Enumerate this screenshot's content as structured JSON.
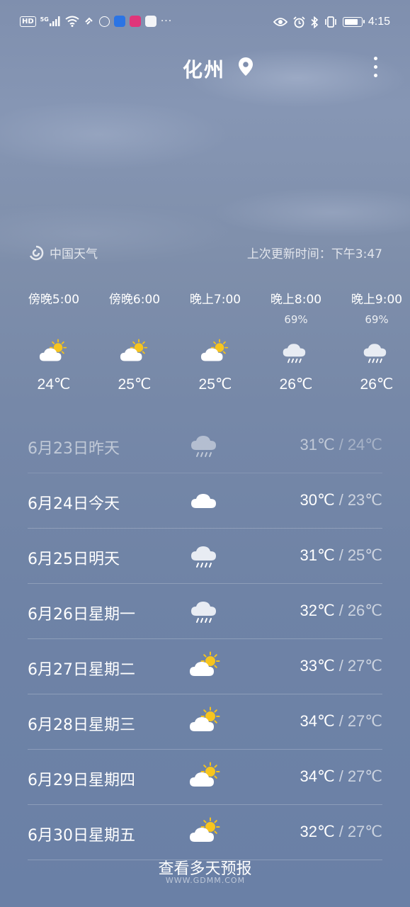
{
  "status_bar": {
    "hd": "HD",
    "network": "5G",
    "time": "4:15",
    "battery_level": 0.85,
    "left_icons": [
      "hd-icon",
      "5g-signal-icon",
      "wifi-icon",
      "sync-icon",
      "jdm-app-icon",
      "bird-app-icon",
      "news-app-icon",
      "qq-app-icon",
      "more-notifications-icon"
    ],
    "right_icons": [
      "eye-comfort-icon",
      "alarm-icon",
      "bluetooth-icon",
      "vibrate-icon",
      "battery-icon"
    ]
  },
  "header": {
    "city": "化州"
  },
  "source": {
    "name": "中国天气",
    "updated_label": "上次更新时间：",
    "updated_time": "下午3:47"
  },
  "hourly": [
    {
      "time": "傍晚5:00",
      "prob": "",
      "temp": "24℃",
      "icon": "partly-sunny-icon"
    },
    {
      "time": "傍晚6:00",
      "prob": "",
      "temp": "25℃",
      "icon": "partly-sunny-icon"
    },
    {
      "time": "晚上7:00",
      "prob": "",
      "temp": "25℃",
      "icon": "partly-sunny-icon"
    },
    {
      "time": "晚上8:00",
      "prob": "69%",
      "temp": "26℃",
      "icon": "rain-icon"
    },
    {
      "time": "晚上9:00",
      "prob": "69%",
      "temp": "26℃",
      "icon": "rain-icon"
    }
  ],
  "daily": [
    {
      "date": "6月23日",
      "day": "昨天",
      "high": "31℃",
      "low": "24℃",
      "icon": "rain-icon",
      "past": true
    },
    {
      "date": "6月24日",
      "day": "今天",
      "high": "30℃",
      "low": "23℃",
      "icon": "cloudy-icon",
      "past": false
    },
    {
      "date": "6月25日",
      "day": "明天",
      "high": "31℃",
      "low": "25℃",
      "icon": "rain-icon",
      "past": false
    },
    {
      "date": "6月26日",
      "day": "星期一",
      "high": "32℃",
      "low": "26℃",
      "icon": "rain-icon",
      "past": false
    },
    {
      "date": "6月27日",
      "day": "星期二",
      "high": "33℃",
      "low": "27℃",
      "icon": "partly-sunny-icon",
      "past": false
    },
    {
      "date": "6月28日",
      "day": "星期三",
      "high": "34℃",
      "low": "27℃",
      "icon": "partly-sunny-icon",
      "past": false
    },
    {
      "date": "6月29日",
      "day": "星期四",
      "high": "34℃",
      "low": "27℃",
      "icon": "partly-sunny-icon",
      "past": false
    },
    {
      "date": "6月30日",
      "day": "星期五",
      "high": "32℃",
      "low": "27℃",
      "icon": "partly-sunny-icon",
      "past": false
    }
  ],
  "daily_separator": "/",
  "more_forecast": "查看多天预报",
  "watermark": "WWW.GDMM.COM"
}
